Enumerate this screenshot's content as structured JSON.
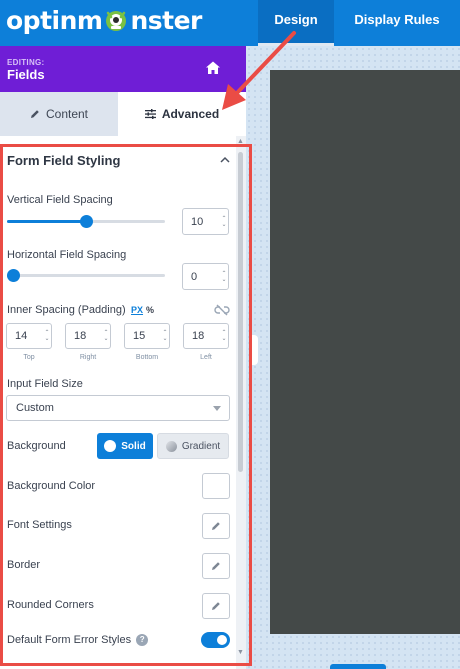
{
  "app": {
    "logo_before": "optinm",
    "logo_after": "nster"
  },
  "nav": {
    "design": "Design",
    "display_rules": "Display Rules"
  },
  "editing": {
    "label": "EDITING:",
    "title": "Fields"
  },
  "tabs": {
    "content": "Content",
    "advanced": "Advanced"
  },
  "section": {
    "title": "Form Field Styling"
  },
  "vertical_spacing": {
    "label": "Vertical Field Spacing",
    "value": "10",
    "slider_fraction": 0.5
  },
  "horizontal_spacing": {
    "label": "Horizontal Field Spacing",
    "value": "0",
    "slider_fraction": 0.0
  },
  "padding": {
    "label": "Inner Spacing (Padding)",
    "unit_px": "PX",
    "unit_pct": "%",
    "top": {
      "value": "14",
      "caption": "Top"
    },
    "right": {
      "value": "18",
      "caption": "Right"
    },
    "bottom": {
      "value": "15",
      "caption": "Bottom"
    },
    "left": {
      "value": "18",
      "caption": "Left"
    }
  },
  "input_size": {
    "label": "Input Field Size",
    "selected": "Custom"
  },
  "background": {
    "label": "Background",
    "solid": "Solid",
    "gradient": "Gradient"
  },
  "background_color": {
    "label": "Background Color",
    "value": "#ffffff"
  },
  "font_settings": {
    "label": "Font Settings"
  },
  "border": {
    "label": "Border"
  },
  "rounded_corners": {
    "label": "Rounded Corners"
  },
  "error_styles": {
    "label": "Default Form Error Styles",
    "help": "?",
    "enabled": true
  },
  "colors": {
    "brand_blue": "#0d7fd9",
    "editing_purple": "#6f1ed6",
    "highlight_red": "#ea4c45"
  },
  "icons": {
    "home": "home-icon",
    "pencil": "pencil-icon",
    "sliders": "sliders-icon",
    "chevron": "chevron-up-icon",
    "unlink": "unlink-icon"
  }
}
